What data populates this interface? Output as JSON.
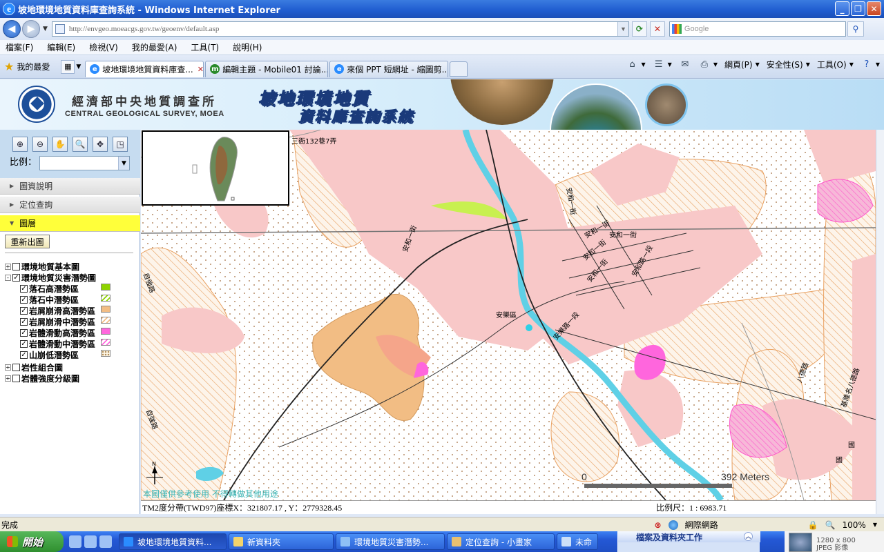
{
  "window": {
    "title": "坡地環境地質資料庫查詢系統 - Windows Internet Explorer",
    "url": "http://envgeo.moeacgs.gov.tw/geoenv/default.asp",
    "search_placeholder": "Google"
  },
  "menu": [
    "檔案(F)",
    "編輯(E)",
    "檢視(V)",
    "我的最愛(A)",
    "工具(T)",
    "說明(H)"
  ],
  "favorites_label": "我的最愛",
  "tabs": [
    {
      "label": "坡地環境地質資料庫查...",
      "active": true
    },
    {
      "label": "編輯主題 - Mobile01 討論...",
      "active": false
    },
    {
      "label": "來個 PPT 短網址 - 縮圖剪...",
      "active": false
    }
  ],
  "commands": {
    "page": "網頁(P)",
    "safety": "安全性(S)",
    "tools": "工具(O)"
  },
  "header": {
    "agency_zh": "經濟部中央地質調查所",
    "agency_en": "CENTRAL GEOLOGICAL SURVEY, MOEA",
    "system_line1": "坡地環境地質",
    "system_line2": "資料庫查詢系統"
  },
  "sidebar": {
    "scale_label": "比例：",
    "sections": [
      {
        "label": "圖資說明",
        "active": false
      },
      {
        "label": "定位查詢",
        "active": false
      },
      {
        "label": "圖層",
        "active": true
      }
    ],
    "redraw_label": "重新出圖",
    "layers": [
      {
        "label": "環境地質基本圖",
        "expander": "+",
        "checked": false
      },
      {
        "label": "環境地質災害潛勢圖",
        "expander": "-",
        "checked": true,
        "children": [
          {
            "label": "落石高潛勢區",
            "checked": true,
            "color": "#8ed400",
            "pattern": "solid"
          },
          {
            "label": "落石中潛勢區",
            "checked": true,
            "color": "#8ed400",
            "pattern": "hatch"
          },
          {
            "label": "岩屑崩滑高潛勢區",
            "checked": true,
            "color": "#f2bd84",
            "pattern": "solid"
          },
          {
            "label": "岩屑崩滑中潛勢區",
            "checked": true,
            "color": "#f2bd84",
            "pattern": "hatch"
          },
          {
            "label": "岩體滑動高潛勢區",
            "checked": true,
            "color": "#ff66dd",
            "pattern": "solid"
          },
          {
            "label": "岩體滑動中潛勢區",
            "checked": true,
            "color": "#ff66dd",
            "pattern": "hatch"
          },
          {
            "label": "山崩低潛勢區",
            "checked": true,
            "color": "#b08a55",
            "pattern": "dots"
          }
        ]
      },
      {
        "label": "岩性組合圖",
        "expander": "+",
        "checked": false
      },
      {
        "label": "岩體強度分級圖",
        "expander": "+",
        "checked": false
      }
    ]
  },
  "map": {
    "road_labels": [
      "三衙132巷7弄",
      "安和一街",
      "安和一街",
      "安和一街",
      "安和一街",
      "安和一街",
      "安和路一段",
      "安和一街",
      "安樂區",
      "安樂路一段",
      "自強路",
      "自強路",
      "八德路",
      "基隆名八德路",
      "國",
      "國"
    ],
    "scale_zero": "0",
    "scale_distance": "392 Meters",
    "north": "N",
    "disclaimer": "本圖僅供參考使用 不得轉做其他用途"
  },
  "coords": {
    "text": "TM2度分帶(TWD97)座標X：321807.17 , Y：2779328.45",
    "ratio": "比例尺：1 : 6983.71"
  },
  "status": {
    "left": "完成",
    "zone": "網際網路",
    "zoom": "100%"
  },
  "taskbar": {
    "start": "開始",
    "items": [
      {
        "label": "坡地環境地質資料...",
        "active": true
      },
      {
        "label": "新資料夾",
        "active": false
      },
      {
        "label": "環境地質災害潛勢...",
        "active": false
      },
      {
        "label": "定位查詢 - 小畫家",
        "active": false
      },
      {
        "label": "未命",
        "active": false
      }
    ],
    "panel_title": "檔案及資料夾工作",
    "image_info": [
      "1280 x 800",
      "JPEG 影像"
    ]
  },
  "colors": {
    "urban": "#f8c8c8",
    "river": "#5fd0e6",
    "debris_hatch": "#e8a060",
    "debris_high": "#f2bd84",
    "rock_high": "#ff66dd",
    "rockfall_high": "#c8f050",
    "highlight_yellow": "#ffff3a"
  }
}
